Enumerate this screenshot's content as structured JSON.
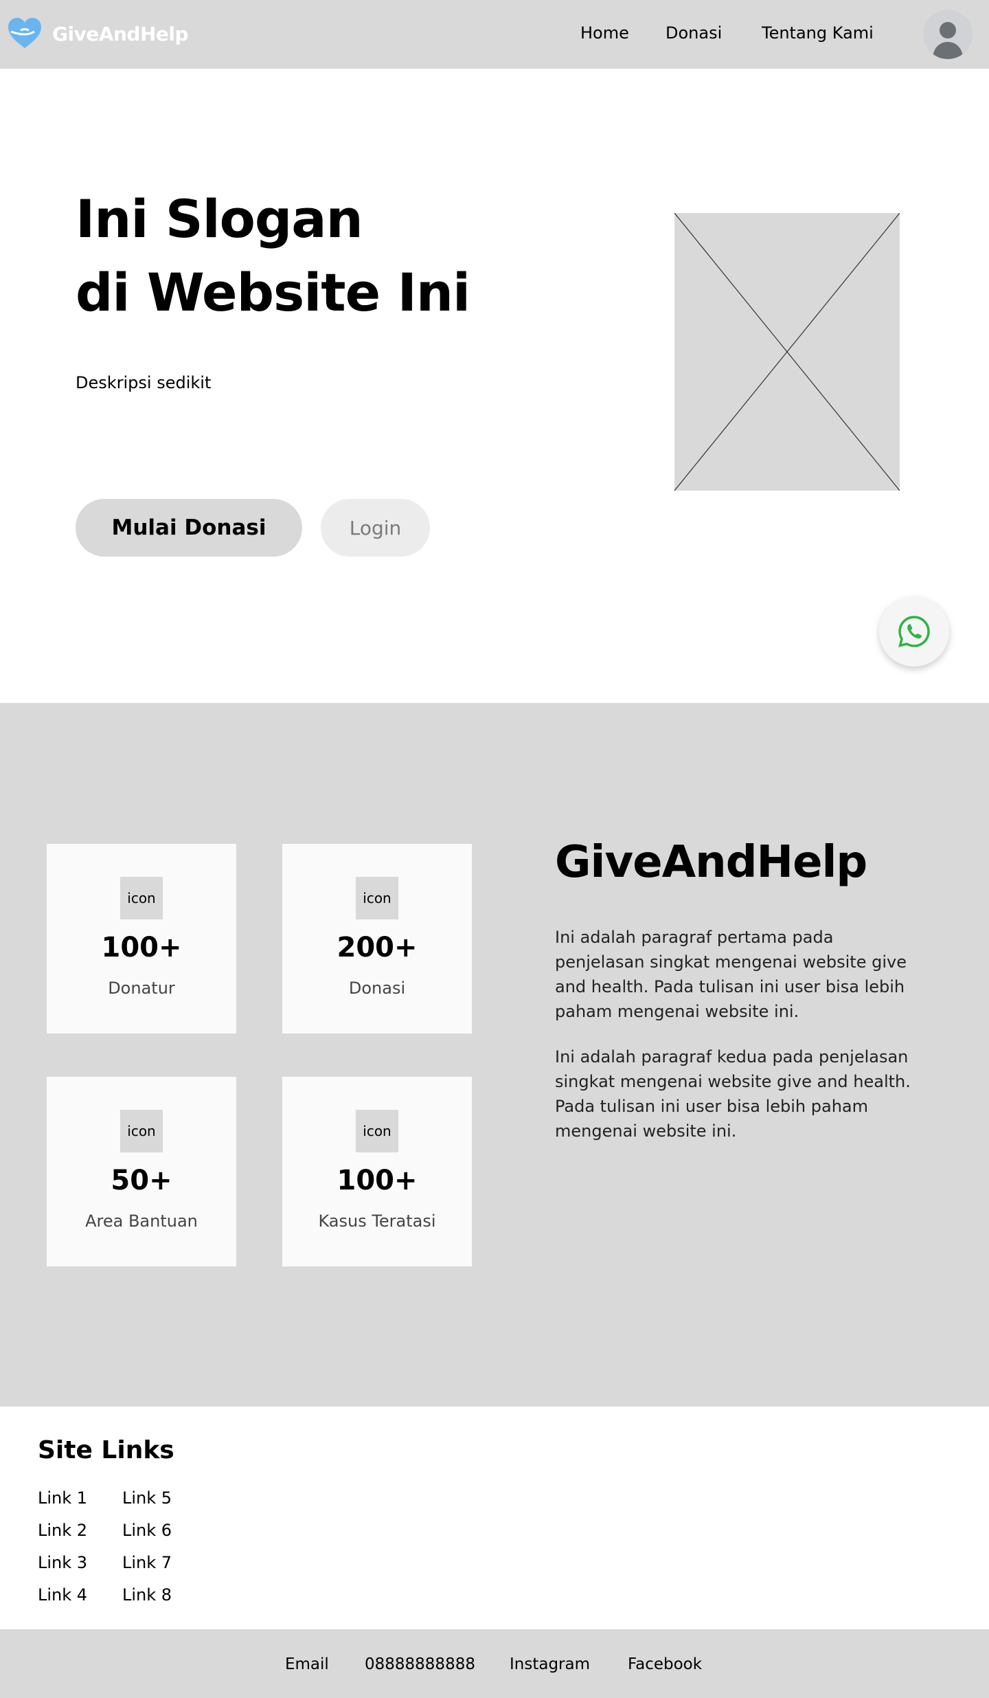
{
  "header": {
    "brand": "GiveAndHelp",
    "nav": {
      "home": "Home",
      "donasi": "Donasi",
      "tentang": "Tentang Kami"
    }
  },
  "hero": {
    "title_line1": "Ini Slogan",
    "title_line2": "di Website Ini",
    "description": "Deskripsi sedikit",
    "primary_button": "Mulai Donasi",
    "secondary_button": "Login"
  },
  "stats": [
    {
      "icon": "icon",
      "value": "100+",
      "label": "Donatur"
    },
    {
      "icon": "icon",
      "value": "200+",
      "label": "Donasi"
    },
    {
      "icon": "icon",
      "value": "50+",
      "label": "Area Bantuan"
    },
    {
      "icon": "icon",
      "value": "100+",
      "label": "Kasus Teratasi"
    }
  ],
  "about": {
    "title": "GiveAndHelp",
    "paragraph1": "Ini adalah paragraf pertama pada penjelasan singkat mengenai website give and health. Pada tulisan ini user bisa lebih paham mengenai website ini.",
    "paragraph2": "Ini adalah paragraf kedua pada penjelasan singkat mengenai website give and health. Pada tulisan ini user bisa lebih paham mengenai website ini."
  },
  "footer": {
    "site_links_title": "Site Links",
    "links": [
      "Link 1",
      "Link 2",
      "Link 3",
      "Link 4",
      "Link 5",
      "Link 6",
      "Link 7",
      "Link 8"
    ],
    "contacts": {
      "email": "Email",
      "phone": "08888888888",
      "instagram": "Instagram",
      "facebook": "Facebook"
    }
  },
  "colors": {
    "header_bg": "#d9d9d9",
    "section_bg": "#d9d9d9",
    "card_bg": "#fafafa",
    "logo_blue": "#6ab4f0",
    "whatsapp_green": "#2fb344"
  },
  "icons": {
    "logo": "heart-hand-icon",
    "avatar": "user-avatar-icon",
    "hero_image": "image-placeholder-icon",
    "chat": "whatsapp-icon"
  }
}
